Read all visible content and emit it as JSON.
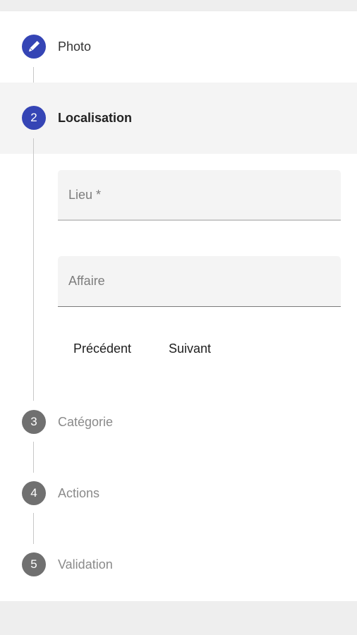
{
  "stepper": {
    "steps": [
      {
        "number": "",
        "icon": "pencil-icon",
        "label": "Photo",
        "state": "done"
      },
      {
        "number": "2",
        "label": "Localisation",
        "state": "active"
      },
      {
        "number": "3",
        "label": "Catégorie",
        "state": "inactive"
      },
      {
        "number": "4",
        "label": "Actions",
        "state": "inactive"
      },
      {
        "number": "5",
        "label": "Validation",
        "state": "inactive"
      }
    ]
  },
  "form": {
    "lieu_placeholder": "Lieu *",
    "affaire_placeholder": "Affaire"
  },
  "buttons": {
    "previous": "Précédent",
    "next": "Suivant"
  },
  "colors": {
    "accent": "#3545b5",
    "inactive_step": "#707070",
    "active_row_bg": "#f4f4f4"
  }
}
